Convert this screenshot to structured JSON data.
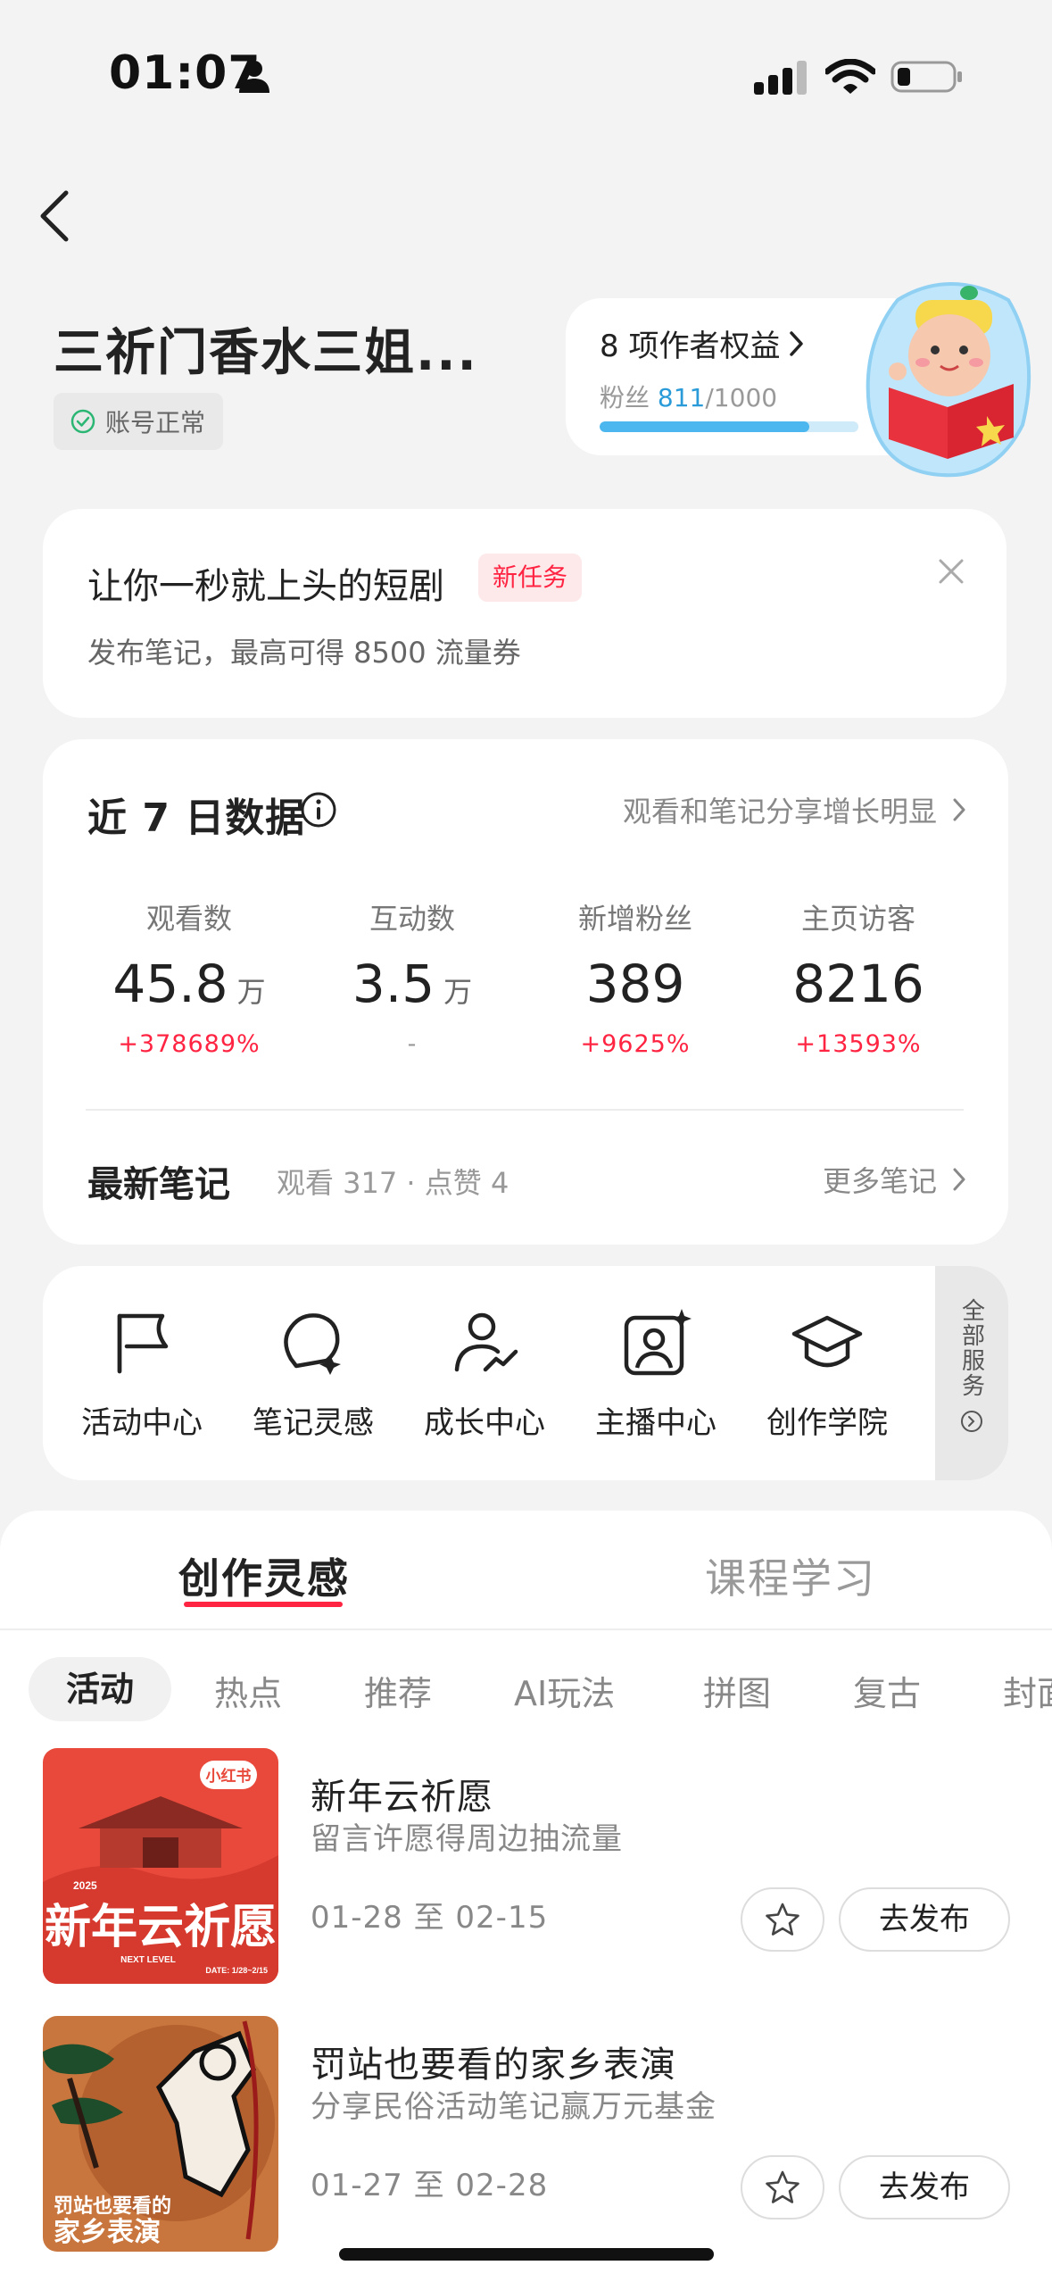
{
  "status_bar": {
    "time": "01:07"
  },
  "profile": {
    "name": "三祈门香水三姐...",
    "account_status": "账号正常"
  },
  "creator_rights": {
    "title": "8 项作者权益",
    "fans_label": "粉丝",
    "fans_current": "811",
    "fans_target": "/1000",
    "progress": 0.811
  },
  "task_card": {
    "title": "让你一秒就上头的短剧",
    "tag": "新任务",
    "description": "发布笔记，最高可得 8500 流量券"
  },
  "data_card": {
    "title": "近 7 日数据",
    "hint": "观看和笔记分享增长明显",
    "metrics": [
      {
        "label": "观看数",
        "value": "45.8",
        "unit": "万",
        "change": "+378689%"
      },
      {
        "label": "互动数",
        "value": "3.5",
        "unit": "万",
        "change": "-"
      },
      {
        "label": "新增粉丝",
        "value": "389",
        "unit": "",
        "change": "+9625%"
      },
      {
        "label": "主页访客",
        "value": "8216",
        "unit": "",
        "change": "+13593%"
      }
    ],
    "latest_notes_label": "最新笔记",
    "latest_notes_stats": "观看 317 · 点赞 4",
    "more_notes": "更多笔记"
  },
  "tools": {
    "items": [
      {
        "label": "活动中心",
        "icon": "flag-icon"
      },
      {
        "label": "笔记灵感",
        "icon": "bulb-icon"
      },
      {
        "label": "成长中心",
        "icon": "growth-user-icon"
      },
      {
        "label": "主播中心",
        "icon": "anchor-icon"
      },
      {
        "label": "创作学院",
        "icon": "graduation-cap-icon"
      }
    ],
    "all_services": "全部服务"
  },
  "sheet": {
    "tabs": [
      "创作灵感",
      "课程学习"
    ],
    "chips": [
      "活动",
      "热点",
      "推荐",
      "AI玩法",
      "拼图",
      "复古",
      "封面"
    ],
    "activities": [
      {
        "title": "新年云祈愿",
        "desc": "留言许愿得周边抽流量",
        "date": "01-28 至 02-15",
        "publish": "去发布",
        "thumb_brand": "小红书",
        "thumb_text": "新年云祈愿",
        "thumb_year": "2025",
        "thumb_sub": "NEXT LEVEL",
        "thumb_date": "DATE: 1/28~2/15",
        "thumb_color": "#e8493b"
      },
      {
        "title": "罚站也要看的家乡表演",
        "desc": "分享民俗活动笔记赢万元基金",
        "date": "01-27 至 02-28",
        "publish": "去发布",
        "thumb_text_1": "罚站也要看的",
        "thumb_text_2": "家乡表演",
        "thumb_color": "#c9763e"
      }
    ]
  },
  "colors": {
    "accent": "#ff2442",
    "progress": "#4cb7ee",
    "link_blue": "#2a9bd8"
  }
}
